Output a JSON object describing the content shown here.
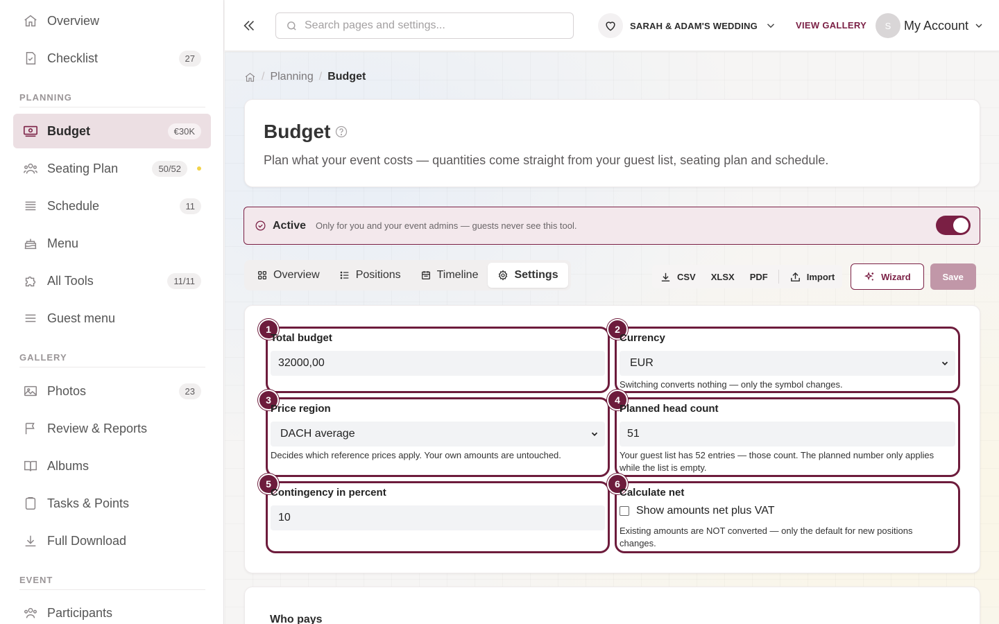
{
  "sidebar": {
    "top_items": [
      {
        "label": "Overview",
        "icon": "home-icon"
      },
      {
        "label": "Checklist",
        "icon": "checklist-icon",
        "badge": "27"
      }
    ],
    "sections": {
      "planning": "PLANNING",
      "gallery": "GALLERY",
      "event": "EVENT"
    },
    "planning_items": [
      {
        "label": "Budget",
        "icon": "budget-icon",
        "badge": "€30K",
        "active": true
      },
      {
        "label": "Seating Plan",
        "icon": "seating-icon",
        "badge": "50/52",
        "dot_color": "#f2d34a"
      },
      {
        "label": "Schedule",
        "icon": "schedule-icon",
        "badge": "11"
      },
      {
        "label": "Menu",
        "icon": "cake-icon"
      },
      {
        "label": "All Tools",
        "icon": "puzzle-icon",
        "badge": "11/11"
      },
      {
        "label": "Guest menu",
        "icon": "hamburger-icon"
      }
    ],
    "gallery_items": [
      {
        "label": "Photos",
        "icon": "image-icon",
        "badge": "23"
      },
      {
        "label": "Review & Reports",
        "icon": "flag-icon"
      },
      {
        "label": "Albums",
        "icon": "book-icon"
      },
      {
        "label": "Tasks & Points",
        "icon": "clipboard-icon"
      },
      {
        "label": "Full Download",
        "icon": "download-icon"
      }
    ],
    "event_items": [
      {
        "label": "Participants",
        "icon": "people-icon"
      }
    ]
  },
  "topbar": {
    "search_placeholder": "Search pages and settings...",
    "event_name": "SARAH & ADAM'S WEDDING",
    "view_gallery": "VIEW GALLERY",
    "avatar_initial": "S",
    "account_label": "My Account"
  },
  "breadcrumb": {
    "items": [
      "Planning",
      "Budget"
    ]
  },
  "header": {
    "title": "Budget",
    "description": "Plan what your event costs — quantities come straight from your guest list, seating plan and schedule."
  },
  "active_bar": {
    "label": "Active",
    "description": "Only for you and your event admins — guests never see this tool.",
    "enabled": true
  },
  "tabs": [
    {
      "label": "Overview",
      "icon": "grid-icon"
    },
    {
      "label": "Positions",
      "icon": "list-icon"
    },
    {
      "label": "Timeline",
      "icon": "calendar-icon"
    },
    {
      "label": "Settings",
      "icon": "gear-icon",
      "active": true
    }
  ],
  "actions": {
    "csv": "CSV",
    "xlsx": "XLSX",
    "pdf": "PDF",
    "import": "Import",
    "wizard": "Wizard",
    "save": "Save"
  },
  "settings": {
    "total_budget": {
      "num": "1",
      "label": "Total budget",
      "value": "32000,00"
    },
    "currency": {
      "num": "2",
      "label": "Currency",
      "value": "EUR",
      "help": "Switching converts nothing — only the symbol changes."
    },
    "price_region": {
      "num": "3",
      "label": "Price region",
      "value": "DACH average",
      "help": "Decides which reference prices apply. Your own amounts are untouched."
    },
    "head_count": {
      "num": "4",
      "label": "Planned head count",
      "value": "51",
      "help": "Your guest list has 52 entries — those count. The planned number only applies while the list is empty."
    },
    "contingency": {
      "num": "5",
      "label": "Contingency in percent",
      "value": "10"
    },
    "calc_net": {
      "num": "6",
      "label": "Calculate net",
      "checkbox_label": "Show amounts net plus VAT",
      "checked": false,
      "help": "Existing amounts are NOT converted — only the default for new positions changes."
    }
  },
  "payer": {
    "title": "Who pays"
  },
  "colors": {
    "accent": "#7a1f44",
    "accent_light": "#f3e8ec",
    "save_disabled": "#c197a8"
  }
}
